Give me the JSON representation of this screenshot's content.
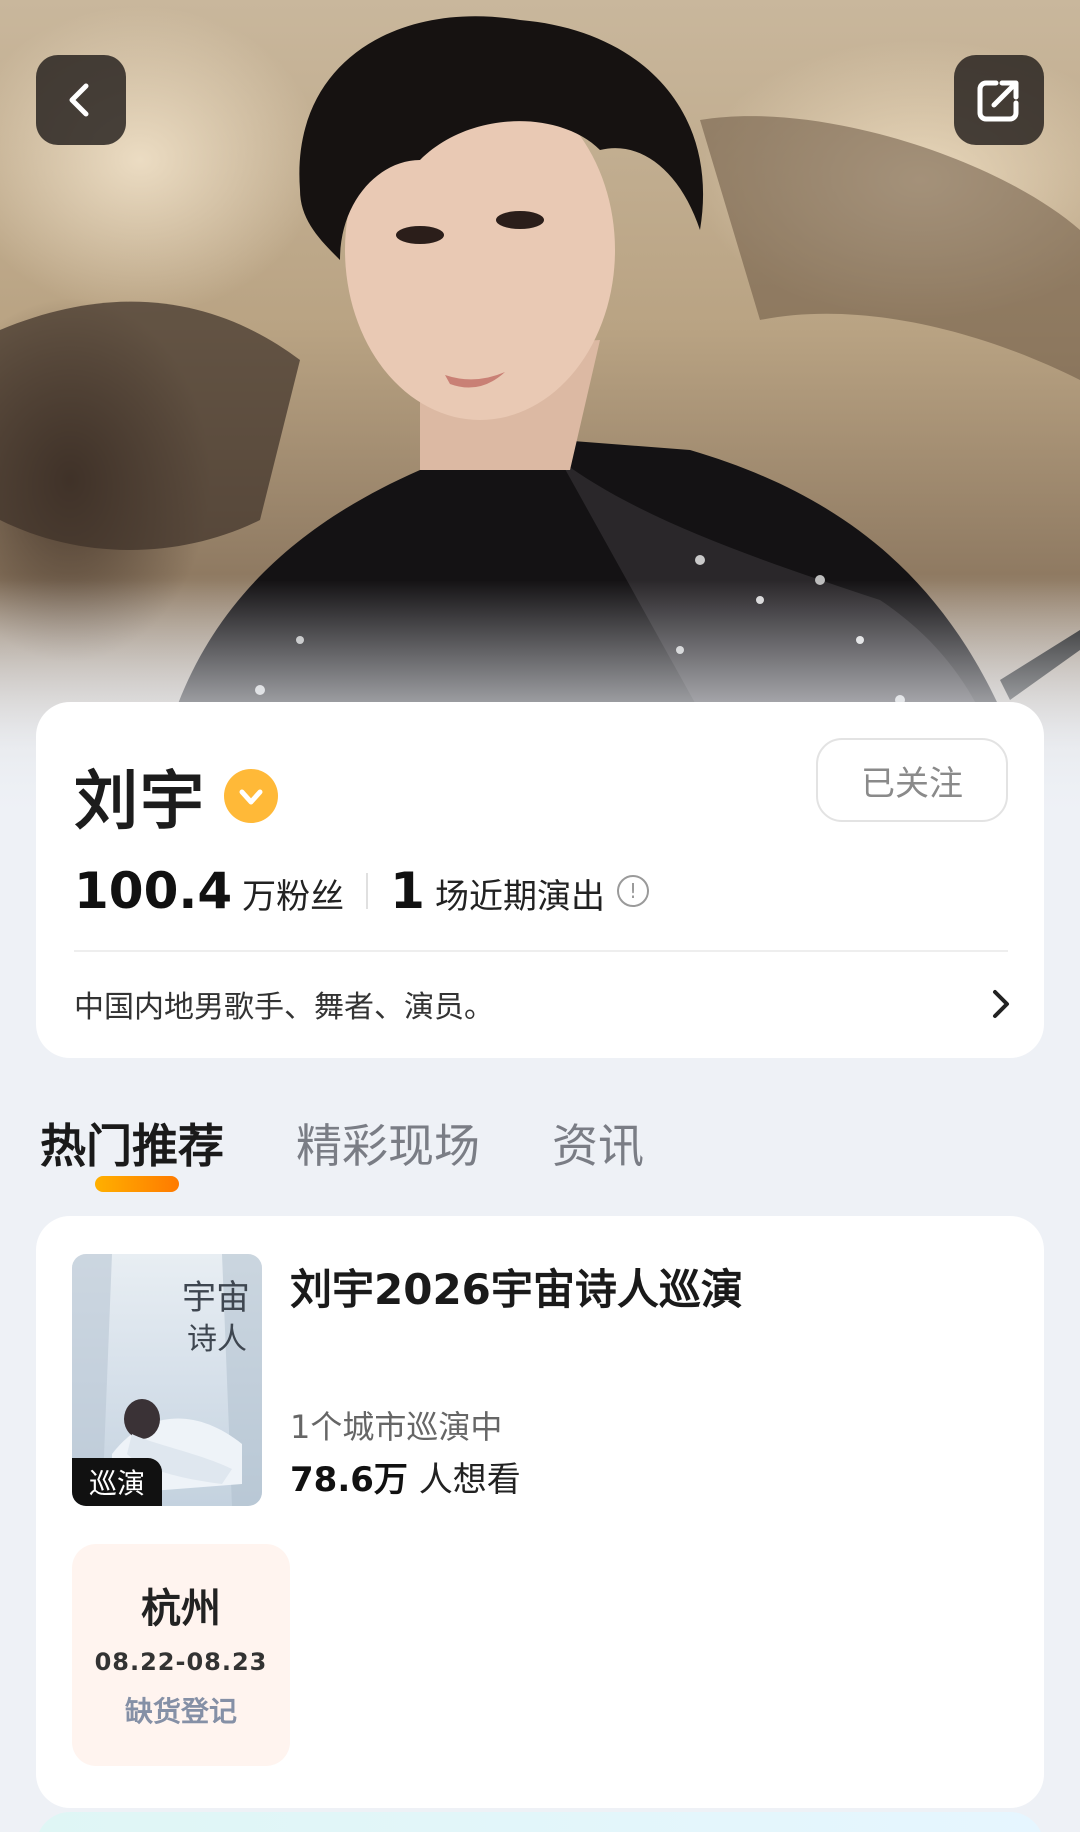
{
  "header": {
    "back_icon": "chevron-left-icon",
    "share_icon": "share-icon"
  },
  "profile": {
    "name": "刘宇",
    "verified_icon": "verified-badge-icon",
    "follow_label": "已关注",
    "fans_value": "100.4",
    "fans_label": "万粉丝",
    "shows_value": "1",
    "shows_label": "场近期演出",
    "bio": "中国内地男歌手、舞者、演员。"
  },
  "tabs": [
    {
      "label": "热门推荐",
      "active": true
    },
    {
      "label": "精彩现场",
      "active": false
    },
    {
      "label": "资讯",
      "active": false
    }
  ],
  "tour": {
    "poster_tag": "巡演",
    "title": "刘宇2026宇宙诗人巡演",
    "cities_text": "1个城市巡演中",
    "want_value": "78.6万",
    "want_label": "人想看",
    "cities": [
      {
        "name": "杭州",
        "dates": "08.22-08.23",
        "status": "缺货登记"
      }
    ]
  },
  "colors": {
    "accent": "#ff9a00",
    "verified": "#ffb938",
    "city_box_bg": "#fff4ef",
    "status_text": "#8590a6"
  }
}
